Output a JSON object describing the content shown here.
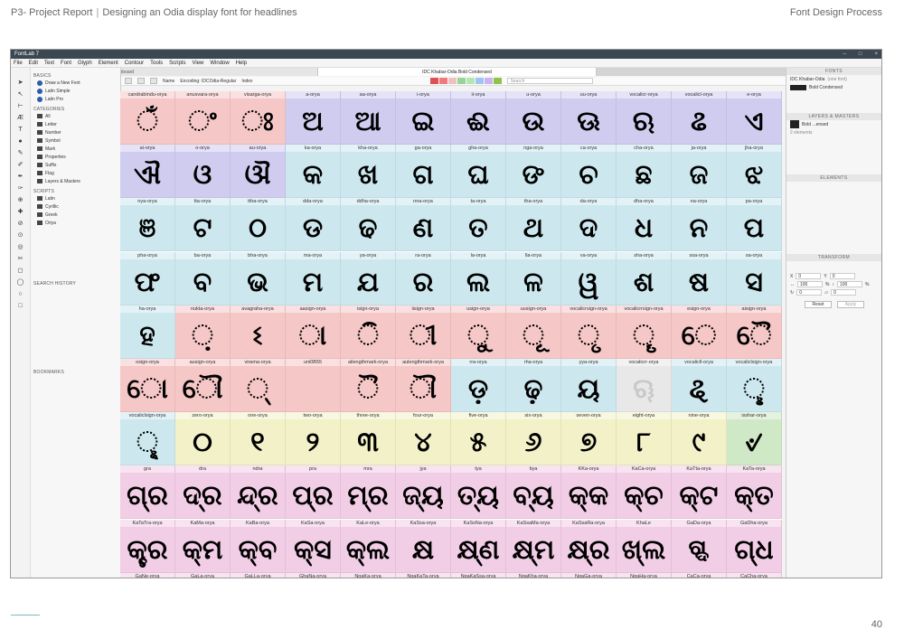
{
  "report": {
    "title": "P3- Project Report",
    "subtitle": "Designing an Odia display font for headlines",
    "section": "Font Design Process",
    "page_number": "40"
  },
  "app": {
    "window_title": "FontLab 7",
    "menu": [
      "File",
      "Edit",
      "Text",
      "Font",
      "Glyph",
      "Element",
      "Contour",
      "Tools",
      "Scripts",
      "View",
      "Window",
      "Help"
    ],
    "tabs": {
      "sketchboard": "Sketchboard",
      "active": "IDC Khabar-Odia Bold Condensed"
    },
    "toolbar": {
      "name_label": "Name",
      "encoding_label": "Encoding: IDCOdia-Regular",
      "index_label": "Index",
      "search_placeholder": "Search",
      "swatches": [
        "#e05050",
        "#f07a7a",
        "#f0c0c0",
        "#9ad29a",
        "#b3e6b3",
        "#a0c4f0",
        "#c9b3f0",
        "#8cc34a"
      ]
    },
    "left_panel": {
      "basics_heading": "BASICS",
      "basics": [
        "Draw a New Font",
        "Latin Simple",
        "Latin Pro"
      ],
      "categories_heading": "CATEGORIES",
      "categories": [
        "All",
        "Letter",
        "Number",
        "Symbol",
        "Mark",
        "Properties",
        "Suffix",
        "Flag",
        "Layers & Masters"
      ],
      "scripts_heading": "SCRIPTS",
      "scripts": [
        "Latin",
        "Cyrillic",
        "Greek",
        "Oriya"
      ],
      "search_history_heading": "SEARCH HISTORY",
      "bookmarks_heading": "BOOKMARKS"
    },
    "right_panel": {
      "fonts_heading": "FONTS",
      "font_name": "IDC Khabar-Odia",
      "font_count": "(one font)",
      "font_style": "Bold Condensed",
      "layers_heading": "LAYERS & MASTERS",
      "layer_name": "Bold ...ensed",
      "layer_count": "2 elements",
      "elements_heading": "ELEMENTS",
      "transform_heading": "TRANSFORM",
      "x_label": "X",
      "x_value": "0",
      "y_label": "Y",
      "y_value": "0",
      "w_value": "100",
      "h_value": "100",
      "pct": "%",
      "rot_value": "0",
      "slant_value": "0",
      "reset_label": "Reset",
      "apply_label": "Apply"
    }
  },
  "glyph_grid": {
    "cells": [
      {
        "name": "candrabindu-orya",
        "glyph": "ଁ",
        "color": "#f6c7c7"
      },
      {
        "name": "anusvara-orya",
        "glyph": "ଂ",
        "color": "#f6c7c7"
      },
      {
        "name": "visarga-orya",
        "glyph": "ଃ",
        "color": "#f6c7c7"
      },
      {
        "name": "a-orya",
        "glyph": "ଅ",
        "color": "#d0ccf0"
      },
      {
        "name": "aa-orya",
        "glyph": "ଆ",
        "color": "#d0ccf0"
      },
      {
        "name": "i-orya",
        "glyph": "ଇ",
        "color": "#d0ccf0"
      },
      {
        "name": "ii-orya",
        "glyph": "ଈ",
        "color": "#d0ccf0"
      },
      {
        "name": "u-orya",
        "glyph": "ଉ",
        "color": "#d0ccf0"
      },
      {
        "name": "uu-orya",
        "glyph": "ଊ",
        "color": "#d0ccf0"
      },
      {
        "name": "vocalicr-orya",
        "glyph": "ଋ",
        "color": "#d0ccf0"
      },
      {
        "name": "vocalicl-orya",
        "glyph": "ଌ",
        "color": "#d0ccf0"
      },
      {
        "name": "e-orya",
        "glyph": "ଏ",
        "color": "#d0ccf0"
      },
      {
        "name": "ai-orya",
        "glyph": "ଐ",
        "color": "#d0ccf0"
      },
      {
        "name": "o-orya",
        "glyph": "ଓ",
        "color": "#d0ccf0"
      },
      {
        "name": "au-orya",
        "glyph": "ଔ",
        "color": "#d0ccf0"
      },
      {
        "name": "ka-orya",
        "glyph": "କ",
        "color": "#cce8ee"
      },
      {
        "name": "kha-orya",
        "glyph": "ଖ",
        "color": "#cce8ee"
      },
      {
        "name": "ga-orya",
        "glyph": "ଗ",
        "color": "#cce8ee"
      },
      {
        "name": "gha-orya",
        "glyph": "ଘ",
        "color": "#cce8ee"
      },
      {
        "name": "nga-orya",
        "glyph": "ଙ",
        "color": "#cce8ee"
      },
      {
        "name": "ca-orya",
        "glyph": "ଚ",
        "color": "#cce8ee"
      },
      {
        "name": "cha-orya",
        "glyph": "ଛ",
        "color": "#cce8ee"
      },
      {
        "name": "ja-orya",
        "glyph": "ଜ",
        "color": "#cce8ee"
      },
      {
        "name": "jha-orya",
        "glyph": "ଝ",
        "color": "#cce8ee"
      },
      {
        "name": "nya-orya",
        "glyph": "ଞ",
        "color": "#cce8ee"
      },
      {
        "name": "tta-orya",
        "glyph": "ଟ",
        "color": "#cce8ee"
      },
      {
        "name": "ttha-orya",
        "glyph": "ଠ",
        "color": "#cce8ee"
      },
      {
        "name": "dda-orya",
        "glyph": "ଡ",
        "color": "#cce8ee"
      },
      {
        "name": "ddha-orya",
        "glyph": "ଢ",
        "color": "#cce8ee"
      },
      {
        "name": "nna-orya",
        "glyph": "ଣ",
        "color": "#cce8ee"
      },
      {
        "name": "ta-orya",
        "glyph": "ତ",
        "color": "#cce8ee"
      },
      {
        "name": "tha-orya",
        "glyph": "ଥ",
        "color": "#cce8ee"
      },
      {
        "name": "da-orya",
        "glyph": "ଦ",
        "color": "#cce8ee"
      },
      {
        "name": "dha-orya",
        "glyph": "ଧ",
        "color": "#cce8ee"
      },
      {
        "name": "na-orya",
        "glyph": "ନ",
        "color": "#cce8ee"
      },
      {
        "name": "pa-orya",
        "glyph": "ପ",
        "color": "#cce8ee"
      },
      {
        "name": "pha-orya",
        "glyph": "ଫ",
        "color": "#cce8ee"
      },
      {
        "name": "ba-orya",
        "glyph": "ବ",
        "color": "#cce8ee"
      },
      {
        "name": "bha-orya",
        "glyph": "ଭ",
        "color": "#cce8ee"
      },
      {
        "name": "ma-orya",
        "glyph": "ମ",
        "color": "#cce8ee"
      },
      {
        "name": "ya-orya",
        "glyph": "ଯ",
        "color": "#cce8ee"
      },
      {
        "name": "ra-orya",
        "glyph": "ର",
        "color": "#cce8ee"
      },
      {
        "name": "la-orya",
        "glyph": "ଲ",
        "color": "#cce8ee"
      },
      {
        "name": "lla-orya",
        "glyph": "ଳ",
        "color": "#cce8ee"
      },
      {
        "name": "va-orya",
        "glyph": "ୱ",
        "color": "#cce8ee"
      },
      {
        "name": "sha-orya",
        "glyph": "ଶ",
        "color": "#cce8ee"
      },
      {
        "name": "ssa-orya",
        "glyph": "ଷ",
        "color": "#cce8ee"
      },
      {
        "name": "sa-orya",
        "glyph": "ସ",
        "color": "#cce8ee"
      },
      {
        "name": "ha-orya",
        "glyph": "ହ",
        "color": "#cce8ee"
      },
      {
        "name": "nukta-orya",
        "glyph": "଼",
        "color": "#f6c7c7"
      },
      {
        "name": "avagraha-orya",
        "glyph": "ଽ",
        "color": "#f6c7c7"
      },
      {
        "name": "aasign-orya",
        "glyph": "ା",
        "color": "#f6c7c7"
      },
      {
        "name": "isign-orya",
        "glyph": "ି",
        "color": "#f6c7c7"
      },
      {
        "name": "iisign-orya",
        "glyph": "ୀ",
        "color": "#f6c7c7"
      },
      {
        "name": "usign-orya",
        "glyph": "ୁ",
        "color": "#f6c7c7"
      },
      {
        "name": "uusign-orya",
        "glyph": "ୂ",
        "color": "#f6c7c7"
      },
      {
        "name": "vocalicrsign-orya",
        "glyph": "ୃ",
        "color": "#f6c7c7"
      },
      {
        "name": "vocalicrrsign-orya",
        "glyph": "ୄ",
        "color": "#f6c7c7"
      },
      {
        "name": "esign-orya",
        "glyph": "େ",
        "color": "#f6c7c7"
      },
      {
        "name": "aisign-orya",
        "glyph": "ୈ",
        "color": "#f6c7c7"
      },
      {
        "name": "osign-orya",
        "glyph": "ୋ",
        "color": "#f6c7c7"
      },
      {
        "name": "ausign-orya",
        "glyph": "ୌ",
        "color": "#f6c7c7"
      },
      {
        "name": "virama-orya",
        "glyph": "୍",
        "color": "#f6c7c7"
      },
      {
        "name": "uni0B55",
        "glyph": "",
        "color": "#f6c7c7"
      },
      {
        "name": "ailengthmark-orya",
        "glyph": "ୖ",
        "color": "#f6c7c7"
      },
      {
        "name": "aulengthmark-orya",
        "glyph": "ୗ",
        "color": "#f6c7c7"
      },
      {
        "name": "rra-orya",
        "glyph": "ଡ଼",
        "color": "#cce8ee"
      },
      {
        "name": "rha-orya",
        "glyph": "ଢ଼",
        "color": "#cce8ee"
      },
      {
        "name": "yya-orya",
        "glyph": "ୟ",
        "color": "#cce8ee"
      },
      {
        "name": "vocalicrr-orya",
        "glyph": "ୠ",
        "color": "#e8e8e8",
        "gray": true
      },
      {
        "name": "vocalicll-orya",
        "glyph": "ୡ",
        "color": "#cce8ee"
      },
      {
        "name": "vocaliclsign-orya",
        "glyph": "ୢ",
        "color": "#cce8ee"
      },
      {
        "name": "vocaliclsign-orya",
        "glyph": "ୣ",
        "color": "#cce8ee"
      },
      {
        "name": "zero-orya",
        "glyph": "୦",
        "color": "#f3f1c8"
      },
      {
        "name": "one-orya",
        "glyph": "୧",
        "color": "#f3f1c8"
      },
      {
        "name": "two-orya",
        "glyph": "୨",
        "color": "#f3f1c8"
      },
      {
        "name": "three-orya",
        "glyph": "୩",
        "color": "#f3f1c8"
      },
      {
        "name": "four-orya",
        "glyph": "୪",
        "color": "#f3f1c8"
      },
      {
        "name": "five-orya",
        "glyph": "୫",
        "color": "#f3f1c8"
      },
      {
        "name": "six-orya",
        "glyph": "୬",
        "color": "#f3f1c8"
      },
      {
        "name": "seven-orya",
        "glyph": "୭",
        "color": "#f3f1c8"
      },
      {
        "name": "eight-orya",
        "glyph": "୮",
        "color": "#f3f1c8"
      },
      {
        "name": "nine-orya",
        "glyph": "୯",
        "color": "#f3f1c8"
      },
      {
        "name": "isshar-orya",
        "glyph": "୰",
        "color": "#cfe8c6"
      },
      {
        "name": "gra",
        "glyph": "ଗ୍ର",
        "color": "#f2cde6"
      },
      {
        "name": "dra",
        "glyph": "ଦ୍ର",
        "color": "#f2cde6"
      },
      {
        "name": "ndra",
        "glyph": "ନ୍ଦ୍ର",
        "color": "#f2cde6"
      },
      {
        "name": "pra",
        "glyph": "ପ୍ର",
        "color": "#f2cde6"
      },
      {
        "name": "mra",
        "glyph": "ମ୍ର",
        "color": "#f2cde6"
      },
      {
        "name": "jya",
        "glyph": "ଜ୍ୟ",
        "color": "#f2cde6"
      },
      {
        "name": "tya",
        "glyph": "ତ୍ୟ",
        "color": "#f2cde6"
      },
      {
        "name": "bya",
        "glyph": "ବ୍ୟ",
        "color": "#f2cde6"
      },
      {
        "name": "KKa-orya",
        "glyph": "କ୍କ",
        "color": "#f2cde6"
      },
      {
        "name": "KaCa-orya",
        "glyph": "କ୍ଚ",
        "color": "#f2cde6"
      },
      {
        "name": "KaTta-orya",
        "glyph": "କ୍ଟ",
        "color": "#f2cde6"
      },
      {
        "name": "KaTa-orya",
        "glyph": "କ୍ତ",
        "color": "#f2cde6"
      },
      {
        "name": "KaTaTra-orya",
        "glyph": "କ୍ତ୍ର",
        "color": "#f2cde6"
      },
      {
        "name": "KaMa-orya",
        "glyph": "କ୍ମ",
        "color": "#f2cde6"
      },
      {
        "name": "KaBa-orya",
        "glyph": "କ୍ବ",
        "color": "#f2cde6"
      },
      {
        "name": "KaSa-orya",
        "glyph": "କ୍ସ",
        "color": "#f2cde6"
      },
      {
        "name": "KaLe-orya",
        "glyph": "କ୍ଲ",
        "color": "#f2cde6"
      },
      {
        "name": "KaSsa-orya",
        "glyph": "କ୍ଷ",
        "color": "#f2cde6"
      },
      {
        "name": "KaSsNa-orya",
        "glyph": "କ୍ଷ୍ଣ",
        "color": "#f2cde6"
      },
      {
        "name": "KaSsaMa-orya",
        "glyph": "କ୍ଷ୍ମ",
        "color": "#f2cde6"
      },
      {
        "name": "KaSsaRa-orya",
        "glyph": "କ୍ଷ୍ର",
        "color": "#f2cde6"
      },
      {
        "name": "KhaLe",
        "glyph": "ଖ୍ଲ",
        "color": "#f2cde6"
      },
      {
        "name": "GaDa-orya",
        "glyph": "ଗ୍ଦ",
        "color": "#f2cde6"
      },
      {
        "name": "GaDha-orya",
        "glyph": "ଗ୍ଧ",
        "color": "#f2cde6"
      }
    ],
    "bottom_labels": [
      "GaNe-orya",
      "GaLa-orya",
      "GaLLa-orya",
      "GhaNa-orya",
      "NgaKa-orya",
      "NgaKaTa-orya",
      "NgaKaSsa-orya",
      "NgaKha-orya",
      "NgaGa-orya",
      "NgaHa-orya",
      "CaCa-orya",
      "CaCha-orya"
    ]
  }
}
